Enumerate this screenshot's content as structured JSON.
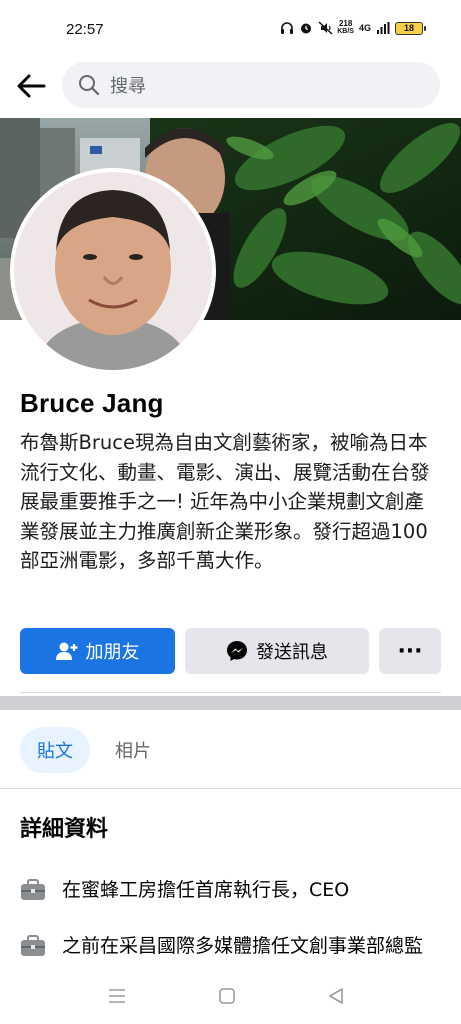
{
  "status_bar": {
    "time": "22:57",
    "speed_value": "218",
    "speed_unit": "KB/S",
    "network": "4G",
    "battery": "18",
    "icons": [
      "headphones-icon",
      "alarm-icon",
      "mute-icon",
      "signal-icon",
      "battery-icon"
    ]
  },
  "header": {
    "search_placeholder": "搜尋"
  },
  "profile": {
    "name": "Bruce Jang",
    "bio": "布魯斯Bruce現為自由文創藝術家，被喻為日本流行文化、動畫、電影、演出、展覽活動在台發展最重要推手之一! 近年為中小企業規劃文創產業發展並主力推廣創新企業形象。發行超過100部亞洲電影，多部千萬大作。"
  },
  "actions": {
    "add_friend": "加朋友",
    "send_message": "發送訊息",
    "more": "···"
  },
  "tabs": [
    {
      "label": "貼文",
      "active": true
    },
    {
      "label": "相片",
      "active": false
    }
  ],
  "details": {
    "title": "詳細資料",
    "items": [
      {
        "icon": "briefcase-icon",
        "text": "在蜜蜂工房擔任首席執行長，CEO"
      },
      {
        "icon": "briefcase-icon",
        "text": "之前在采昌國際多媒體擔任文創事業部總監"
      }
    ]
  },
  "colors": {
    "accent": "#1b74e4",
    "button_secondary": "#e4e6eb",
    "search_bg": "#f0f2f5",
    "active_tab_bg": "#e7f3ff"
  }
}
